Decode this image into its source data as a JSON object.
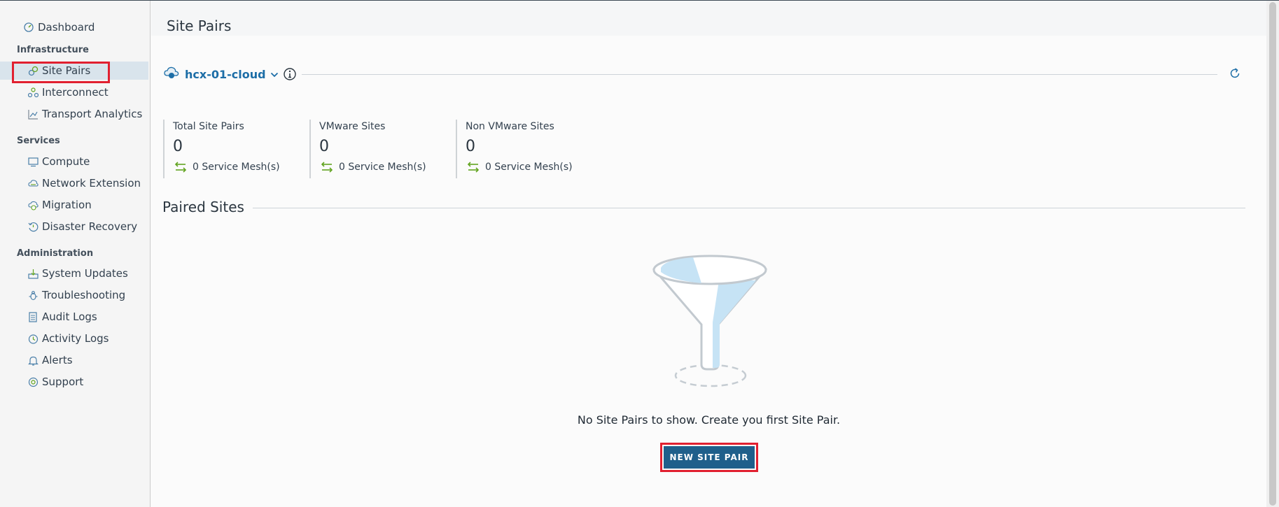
{
  "sidebar": {
    "dashboard": "Dashboard",
    "sections": {
      "infrastructure": "Infrastructure",
      "services": "Services",
      "administration": "Administration"
    },
    "items": {
      "site_pairs": "Site Pairs",
      "interconnect": "Interconnect",
      "transport_analytics": "Transport Analytics",
      "compute": "Compute",
      "network_extension": "Network Extension",
      "migration": "Migration",
      "disaster_recovery": "Disaster Recovery",
      "system_updates": "System Updates",
      "troubleshooting": "Troubleshooting",
      "audit_logs": "Audit Logs",
      "activity_logs": "Activity Logs",
      "alerts": "Alerts",
      "support": "Support"
    },
    "active": "Site Pairs"
  },
  "header": {
    "title": "Site Pairs"
  },
  "site_selector": {
    "value": "hcx-01-cloud"
  },
  "stats": [
    {
      "label": "Total Site Pairs",
      "count": "0",
      "mesh": "0 Service Mesh(s)"
    },
    {
      "label": "VMware Sites",
      "count": "0",
      "mesh": "0 Service Mesh(s)"
    },
    {
      "label": "Non VMware Sites",
      "count": "0",
      "mesh": "0 Service Mesh(s)"
    }
  ],
  "paired_sites": {
    "title": "Paired Sites",
    "empty_message": "No Site Pairs to show. Create you first Site Pair.",
    "new_button": "NEW SITE PAIR"
  },
  "colors": {
    "accent": "#1d6ea7",
    "button": "#1f5f8b",
    "highlight": "#e12030",
    "mesh_icon": "#62a420"
  }
}
